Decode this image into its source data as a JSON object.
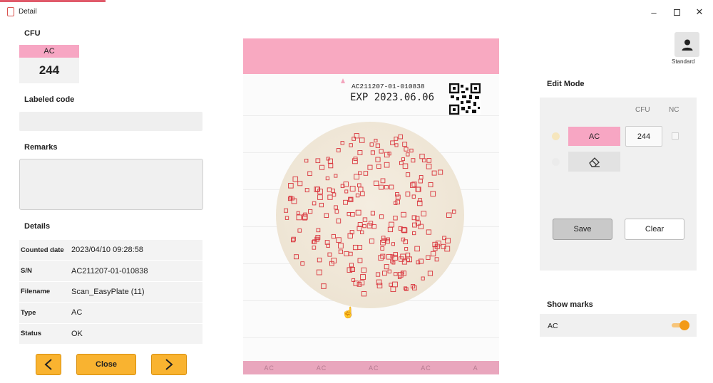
{
  "window": {
    "title": "Detail",
    "icon": "app-document-icon",
    "controls": [
      "minimize-icon",
      "maximize-icon",
      "close-icon"
    ]
  },
  "left": {
    "cfu_label": "CFU",
    "cfu_type": "AC",
    "cfu_count": "244",
    "labeled_code_label": "Labeled code",
    "labeled_code_value": "",
    "remarks_label": "Remarks",
    "remarks_value": "",
    "details_label": "Details",
    "details": [
      {
        "key": "Counted date",
        "value": "2023/04/10 09:28:58"
      },
      {
        "key": "S/N",
        "value": "AC211207-01-010838"
      },
      {
        "key": "Filename",
        "value": "Scan_EasyPlate (11)"
      },
      {
        "key": "Type",
        "value": "AC"
      },
      {
        "key": "Status",
        "value": "OK"
      }
    ],
    "buttons": {
      "prev": "chevron-left-icon",
      "close": "Close",
      "next": "chevron-right-icon"
    }
  },
  "plate": {
    "serial": "AC211207-01-010838",
    "expiry": "EXP 2023.06.06",
    "footer_labels": [
      "AC",
      "AC",
      "AC",
      "AC",
      "A"
    ],
    "colors": {
      "band": "#f8a9c1",
      "mark": "#d9363e",
      "disk": "#efe6d6"
    }
  },
  "right": {
    "user_label": "Standard",
    "edit_mode_label": "Edit Mode",
    "col_cfu": "CFU",
    "col_nc": "NC",
    "ac_button": "AC",
    "cfu_input_value": "244",
    "save": "Save",
    "clear": "Clear",
    "show_marks_label": "Show marks",
    "show_marks_item": "AC",
    "show_marks_on": true,
    "colors": {
      "accent": "#f39a17",
      "ac_pink": "#f7a6c3"
    }
  }
}
